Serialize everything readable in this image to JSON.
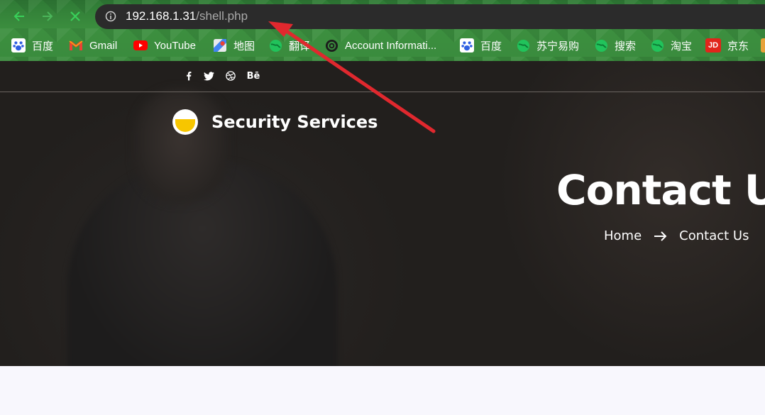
{
  "browser": {
    "url_host": "192.168.1.31",
    "url_path": "/shell.php",
    "bookmarks": [
      {
        "label": "百度",
        "icon": "baidu-icon"
      },
      {
        "label": "Gmail",
        "icon": "gmail-icon"
      },
      {
        "label": "YouTube",
        "icon": "youtube-icon"
      },
      {
        "label": "地图",
        "icon": "maps-icon"
      },
      {
        "label": "翻译",
        "icon": "globe-icon"
      },
      {
        "label": "Account Informati...",
        "icon": "account-icon"
      },
      {
        "label": "百度",
        "icon": "baidu-icon"
      },
      {
        "label": "苏宁易购",
        "icon": "globe-icon"
      },
      {
        "label": "搜索",
        "icon": "globe-icon"
      },
      {
        "label": "淘宝",
        "icon": "globe-icon"
      },
      {
        "label": "京东",
        "icon": "jd-icon"
      }
    ],
    "jd_badge": "JD"
  },
  "site": {
    "brand": "Security Services",
    "hero_title": "Contact Us",
    "breadcrumb": {
      "home": "Home",
      "current": "Contact Us"
    },
    "social": [
      "facebook-icon",
      "twitter-icon",
      "dribbble-icon",
      "behance-icon"
    ],
    "behance_text": "Bē"
  },
  "colors": {
    "chrome_green": "#3a8b3d",
    "annotation_red": "#e0282e",
    "logo_yellow": "#f7c600"
  }
}
